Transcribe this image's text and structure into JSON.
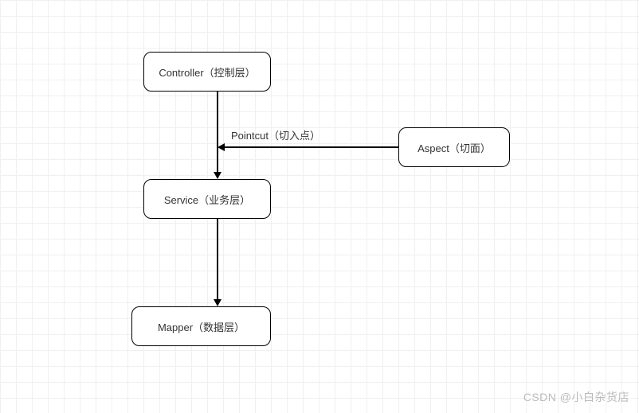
{
  "diagram": {
    "nodes": {
      "controller": {
        "label": "Controller（控制层）"
      },
      "service": {
        "label": "Service（业务层）"
      },
      "mapper": {
        "label": "Mapper（数据层）"
      },
      "aspect": {
        "label": "Aspect（切面）"
      }
    },
    "edges": {
      "pointcut_label": "Pointcut（切入点）"
    }
  },
  "watermark": "CSDN @小白杂货店"
}
